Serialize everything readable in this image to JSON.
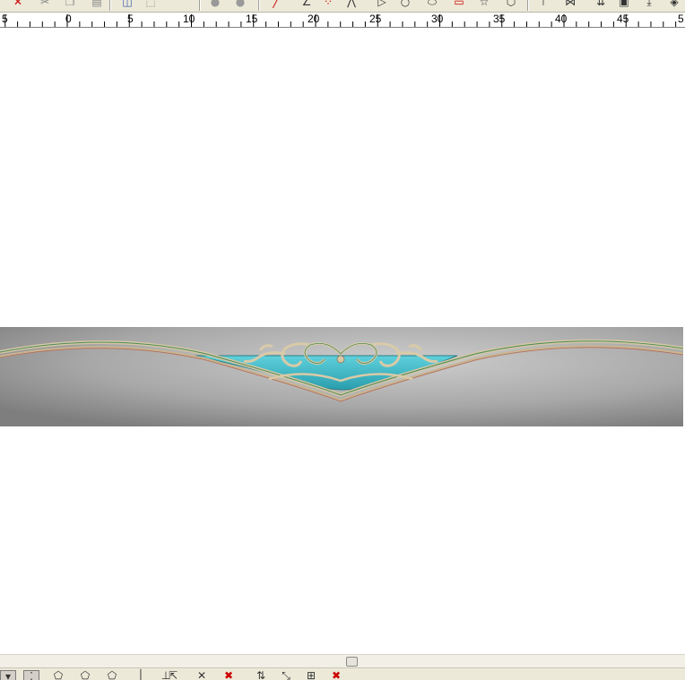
{
  "toolbar_top": {
    "buttons": [
      {
        "icon": "delete-x-icon",
        "glyph": "✕",
        "color": "#cc0000"
      },
      {
        "icon": "cut-icon",
        "glyph": "✂",
        "color": "#888888"
      },
      {
        "icon": "copy-icon",
        "glyph": "❐",
        "color": "#888888"
      },
      {
        "icon": "paste-icon",
        "glyph": "▤",
        "color": "#888888"
      },
      {
        "icon": "layer-icon",
        "glyph": "◫",
        "color": "#3355aa"
      },
      {
        "icon": "transform-icon",
        "glyph": "⬚",
        "color": "#888888"
      },
      {
        "icon": "circle-gray-icon",
        "glyph": "●",
        "color": "#999999"
      },
      {
        "icon": "circle-gray-2-icon",
        "glyph": "●",
        "color": "#999999"
      },
      {
        "icon": "line-icon",
        "glyph": "╱",
        "color": "#cc0000"
      },
      {
        "icon": "angle-icon",
        "glyph": "∠",
        "color": "#333333"
      },
      {
        "icon": "points-icon",
        "glyph": "⁘",
        "color": "#cc0000"
      },
      {
        "icon": "polyline-icon",
        "glyph": "⋀",
        "color": "#333333"
      },
      {
        "icon": "triangle-icon",
        "glyph": "▷",
        "color": "#333333"
      },
      {
        "icon": "circle-icon",
        "glyph": "○",
        "color": "#333333"
      },
      {
        "icon": "ellipse-icon",
        "glyph": "⬭",
        "color": "#333333"
      },
      {
        "icon": "rectangle-icon",
        "glyph": "▭",
        "color": "#cc0000"
      },
      {
        "icon": "star-icon",
        "glyph": "☆",
        "color": "#333333"
      },
      {
        "icon": "polygon-icon",
        "glyph": "⬡",
        "color": "#333333"
      },
      {
        "icon": "node-icon",
        "glyph": "⊤",
        "color": "#333333"
      },
      {
        "icon": "mirror-icon",
        "glyph": "⋈",
        "color": "#333333"
      },
      {
        "icon": "align-icon",
        "glyph": "⇊",
        "color": "#333333"
      },
      {
        "icon": "box-icon",
        "glyph": "▣",
        "color": "#333333"
      },
      {
        "icon": "down-arrow-icon",
        "glyph": "⤓",
        "color": "#333333"
      },
      {
        "icon": "diamond-icon",
        "glyph": "◈",
        "color": "#333333"
      }
    ]
  },
  "ruler": {
    "labels": [
      "5",
      "0",
      "5",
      "10",
      "15",
      "20",
      "25",
      "30",
      "35",
      "40",
      "45",
      "5"
    ]
  },
  "relief": {
    "background_dark": "#8a8a8a",
    "background_light": "#c9c9c9",
    "turquoise": "#3ab4c2",
    "gold": "#c4b08a"
  },
  "toolbar_bottom": {
    "buttons": [
      {
        "icon": "select-tool-icon",
        "glyph": "▾",
        "pressed": true
      },
      {
        "icon": "node-tool-icon",
        "glyph": "⁚",
        "pressed": true
      },
      {
        "icon": "shape-a-icon",
        "glyph": "⬠",
        "pressed": false
      },
      {
        "icon": "shape-b-icon",
        "glyph": "⬠",
        "pressed": false
      },
      {
        "icon": "shape-c-icon",
        "glyph": "⬠",
        "pressed": false
      },
      {
        "icon": "vline-icon",
        "glyph": "│",
        "pressed": false
      },
      {
        "icon": "hline-icon",
        "glyph": "⊥",
        "pressed": false
      },
      {
        "icon": "arrow-left-icon",
        "glyph": "⇱",
        "pressed": false
      },
      {
        "icon": "cross-icon",
        "glyph": "✕",
        "pressed": false
      },
      {
        "icon": "cross-red-icon",
        "glyph": "✖",
        "pressed": false
      },
      {
        "icon": "arrows-v-icon",
        "glyph": "⇅",
        "pressed": false
      },
      {
        "icon": "arrows-diag-icon",
        "glyph": "⤡",
        "pressed": false
      },
      {
        "icon": "grid-icon",
        "glyph": "⊞",
        "pressed": false
      },
      {
        "icon": "delete-red-icon",
        "glyph": "✖",
        "pressed": false
      }
    ]
  }
}
